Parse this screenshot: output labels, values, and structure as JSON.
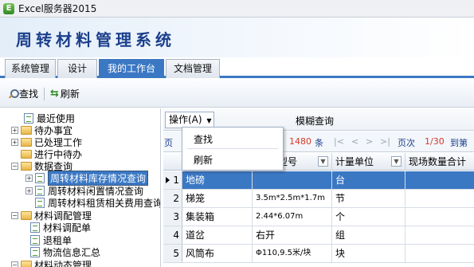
{
  "window": {
    "title": "Excel服务器2015"
  },
  "banner": {
    "title": "周转材料管理系统"
  },
  "tabs": [
    {
      "label": "系统管理"
    },
    {
      "label": "设计"
    },
    {
      "label": "我的工作台"
    },
    {
      "label": "文档管理"
    }
  ],
  "toolbar": {
    "search_label": "查找",
    "refresh_label": "刷新"
  },
  "tree": {
    "items": [
      {
        "label": "最近使用"
      },
      {
        "label": "待办事宜"
      },
      {
        "label": "已处理工作"
      },
      {
        "label": "进行中待办"
      },
      {
        "label": "数据查询"
      },
      {
        "label": "周转材料库存情况查询"
      },
      {
        "label": "周转材料闲置情况查询"
      },
      {
        "label": "周转材料租赁相关费用查询"
      },
      {
        "label": "材料调配管理"
      },
      {
        "label": "材料调配单"
      },
      {
        "label": "退租单"
      },
      {
        "label": "物流信息汇总"
      },
      {
        "label": "材料动态管理"
      }
    ]
  },
  "op_bar": {
    "ops_label": "操作(A)",
    "vague_query": "模糊查询"
  },
  "menu": {
    "items": [
      {
        "label": "查找"
      },
      {
        "label": "刷新"
      }
    ]
  },
  "pager": {
    "left_mark": "页",
    "total": "1480",
    "unit": "条",
    "page_label": "页次",
    "page_value": "1/30",
    "goto": "到第"
  },
  "grid": {
    "columns": [
      {
        "label": "型号"
      },
      {
        "label": "计量单位"
      },
      {
        "label": "现场数量合计"
      }
    ],
    "rows": [
      {
        "num": "1",
        "name": "地磅",
        "model": "",
        "unit": "台"
      },
      {
        "num": "2",
        "name": "梯笼",
        "model": "3.5m*2.5m*1.7m",
        "unit": "节"
      },
      {
        "num": "3",
        "name": "集装箱",
        "model": "2.44*6.07m",
        "unit": "个"
      },
      {
        "num": "4",
        "name": "道岔",
        "model": "右开",
        "unit": "组"
      },
      {
        "num": "5",
        "name": "风筒布",
        "model": "Φ110,9.5米/块",
        "unit": "块"
      }
    ]
  }
}
